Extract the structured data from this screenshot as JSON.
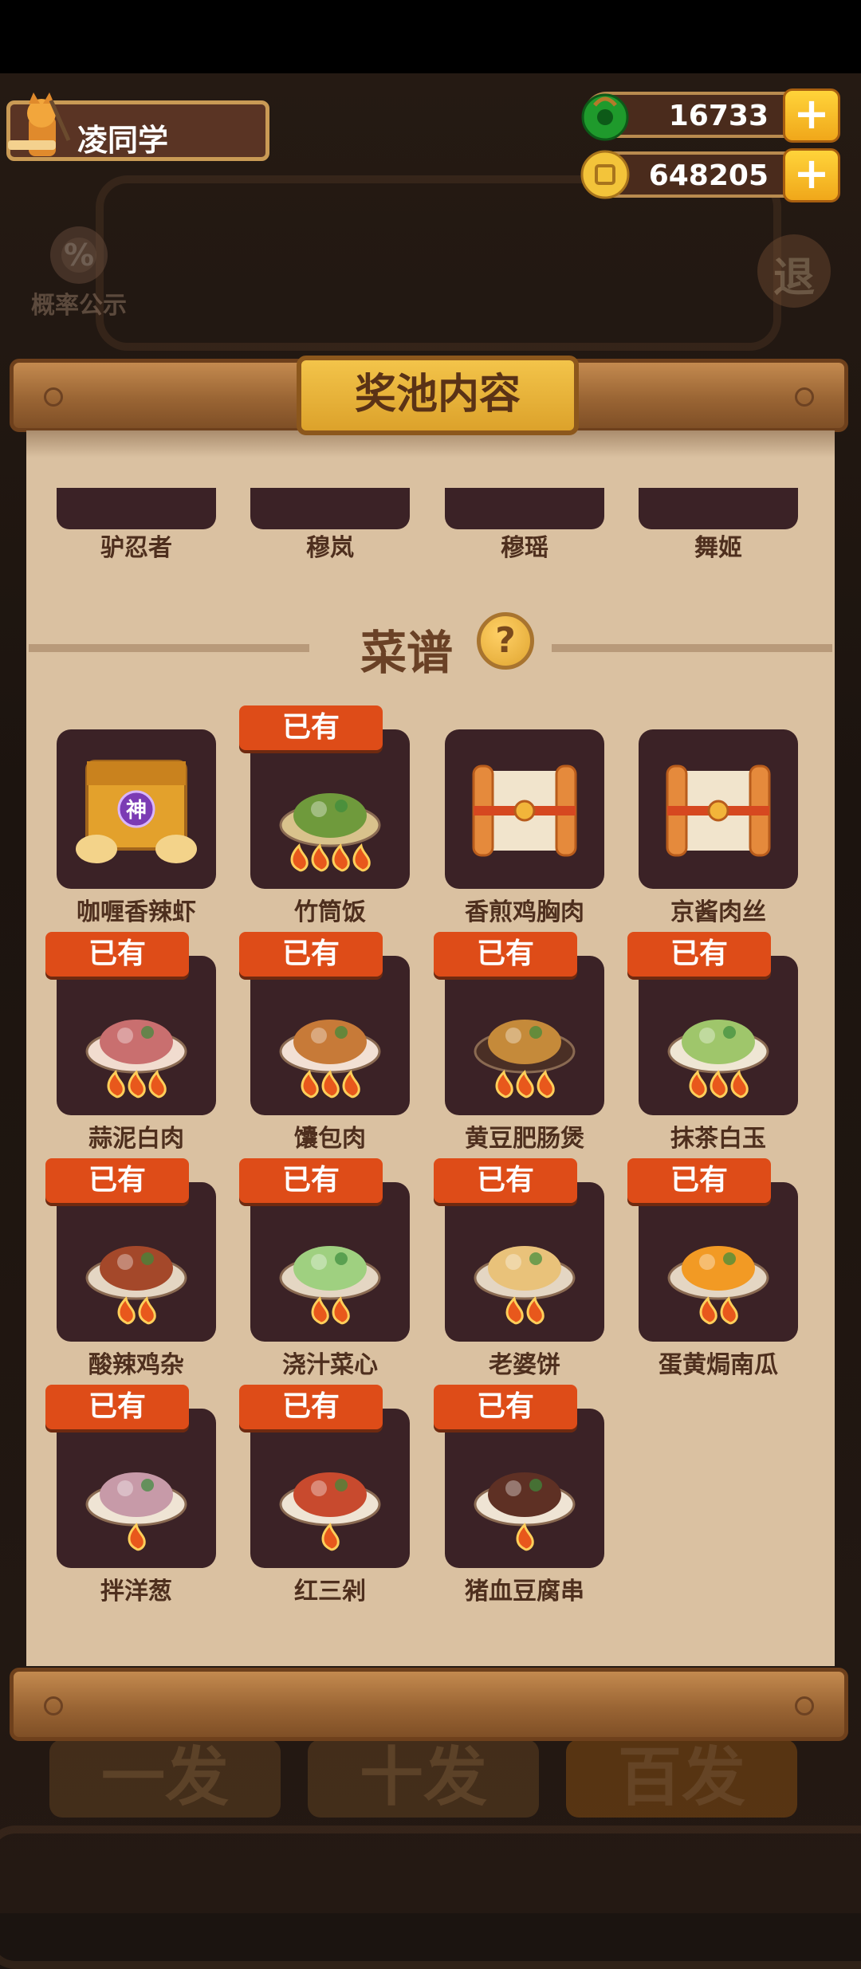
{
  "player": {
    "name": "凌同学"
  },
  "currency": {
    "gems": "16733",
    "coins": "648205",
    "plus": "+"
  },
  "background": {
    "probability_label": "概率公示",
    "probability_symbol": "%",
    "exit_label": "退",
    "bottom_buttons": [
      "一发",
      "十发",
      "百发"
    ]
  },
  "panel": {
    "title": "奖池内容"
  },
  "partial_row": [
    "驴忍者",
    "穆岚",
    "穆瑶",
    "舞姬"
  ],
  "recipes": {
    "title": "菜谱",
    "help_symbol": "?",
    "owned_label": "已有",
    "special_mark": "神",
    "items": [
      {
        "name": "咖喱香辣虾",
        "owned": false,
        "kind": "chest"
      },
      {
        "name": "竹筒饭",
        "owned": true,
        "kind": "dish",
        "plate": "#d9c28c",
        "food": "#6f9a3c",
        "stars": 4
      },
      {
        "name": "香煎鸡胸肉",
        "owned": false,
        "kind": "scroll"
      },
      {
        "name": "京酱肉丝",
        "owned": false,
        "kind": "scroll"
      },
      {
        "name": "蒜泥白肉",
        "owned": true,
        "kind": "dish",
        "plate": "#f1dccf",
        "food": "#c96f6f",
        "stars": 3
      },
      {
        "name": "馕包肉",
        "owned": true,
        "kind": "dish",
        "plate": "#f2e0d4",
        "food": "#c77a38",
        "stars": 3
      },
      {
        "name": "黄豆肥肠煲",
        "owned": true,
        "kind": "dish",
        "plate": "#4a2f25",
        "food": "#c58a3a",
        "stars": 3
      },
      {
        "name": "抹茶白玉",
        "owned": true,
        "kind": "dish",
        "plate": "#efe6d4",
        "food": "#9fc66b",
        "stars": 3
      },
      {
        "name": "酸辣鸡杂",
        "owned": true,
        "kind": "dish",
        "plate": "#e4d6c3",
        "food": "#a4482a",
        "stars": 2
      },
      {
        "name": "浇汁菜心",
        "owned": true,
        "kind": "dish",
        "plate": "#e4d6c3",
        "food": "#9fd080",
        "stars": 2
      },
      {
        "name": "老婆饼",
        "owned": true,
        "kind": "dish",
        "plate": "#e4d6c3",
        "food": "#e9c27a",
        "stars": 2
      },
      {
        "name": "蛋黄焗南瓜",
        "owned": true,
        "kind": "dish",
        "plate": "#e4d6c3",
        "food": "#f29a24",
        "stars": 2
      },
      {
        "name": "拌洋葱",
        "owned": true,
        "kind": "dish",
        "plate": "#efe4d4",
        "food": "#c79aa8",
        "stars": 1
      },
      {
        "name": "红三剁",
        "owned": true,
        "kind": "dish",
        "plate": "#efe4d4",
        "food": "#c84a2e",
        "stars": 1
      },
      {
        "name": "猪血豆腐串",
        "owned": true,
        "kind": "dish",
        "plate": "#efe4d4",
        "food": "#5e3024",
        "stars": 1
      }
    ]
  }
}
